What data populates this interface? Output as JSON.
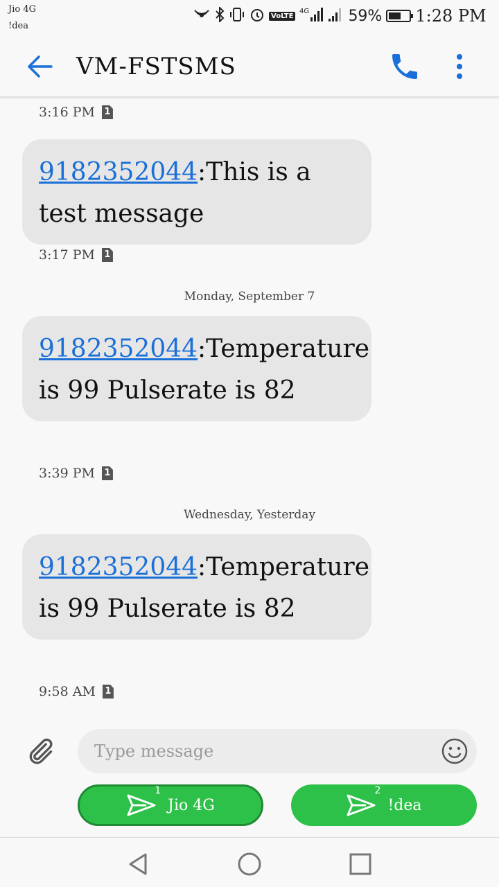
{
  "status_bar": {
    "carrier_1": "Jio 4G",
    "carrier_2": "!dea",
    "volte": "VoLTE",
    "network": "4G",
    "signal_sup": "3",
    "battery_percent": "59%",
    "battery_level": 0.59,
    "time": "1:28 PM"
  },
  "header": {
    "title": "VM-FSTSMS",
    "back_icon": "arrow-left-icon",
    "call_icon": "phone-icon",
    "menu_icon": "more-vertical-icon",
    "accent_color": "#1a6fd8"
  },
  "messages": [
    {
      "type": "meta",
      "time": "3:16 PM",
      "sim": "1"
    },
    {
      "type": "message",
      "phone": "9182352044",
      "text": ":This is a test message",
      "time": "3:17 PM",
      "sim": "1"
    },
    {
      "type": "divider",
      "label": "Monday, September 7"
    },
    {
      "type": "message",
      "phone": "9182352044",
      "text": ":Temperature is 99 Pulserate is 82",
      "time": "3:39 PM",
      "sim": "1"
    },
    {
      "type": "divider",
      "label": "Wednesday, Yesterday"
    },
    {
      "type": "message",
      "phone": "9182352044",
      "text": ":Temperature is 99 Pulserate is 82",
      "time": "9:58 AM",
      "sim": "1"
    }
  ],
  "composer": {
    "placeholder": "Type message",
    "attach_icon": "paperclip-icon",
    "emoji_icon": "smiley-icon"
  },
  "send_buttons": [
    {
      "label": "Jio 4G",
      "sim": "1",
      "icon": "send-icon"
    },
    {
      "label": "!dea",
      "sim": "2",
      "icon": "send-icon"
    }
  ],
  "nav": {
    "back_icon": "triangle-back-icon",
    "home_icon": "circle-home-icon",
    "recents_icon": "square-recents-icon"
  },
  "colors": {
    "bubble": "#e6e6e6",
    "send_green": "#2ec14a",
    "link_blue": "#1a6fd8"
  }
}
